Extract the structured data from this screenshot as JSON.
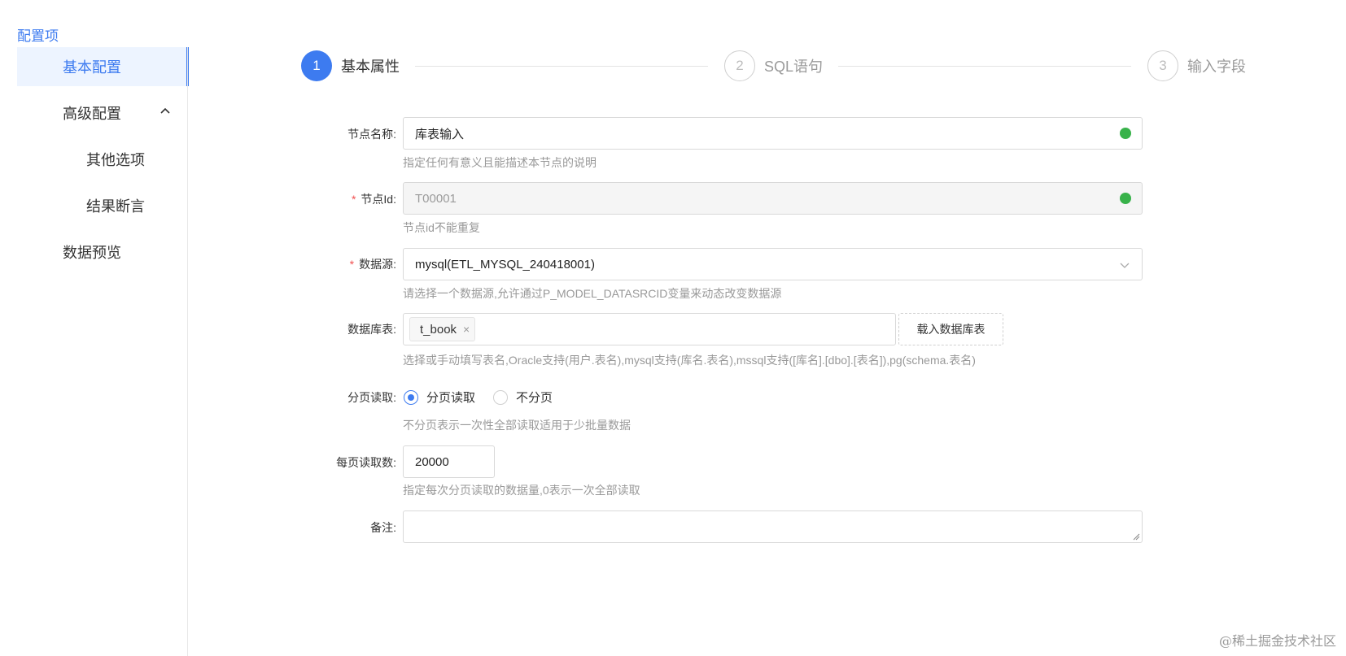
{
  "sidebar": {
    "title": "配置项",
    "items": [
      {
        "label": "基本配置"
      },
      {
        "label": "高级配置"
      },
      {
        "label": "其他选项"
      },
      {
        "label": "结果断言"
      },
      {
        "label": "数据预览"
      }
    ]
  },
  "steps": [
    {
      "number": "1",
      "label": "基本属性"
    },
    {
      "number": "2",
      "label": "SQL语句"
    },
    {
      "number": "3",
      "label": "输入字段"
    }
  ],
  "form": {
    "node_name": {
      "label": "节点名称:",
      "value": "库表输入",
      "hint": "指定任何有意义且能描述本节点的说明"
    },
    "node_id": {
      "required": "*",
      "label": "节点Id:",
      "value": "T00001",
      "hint": "节点id不能重复"
    },
    "datasource": {
      "required": "*",
      "label": "数据源:",
      "value": "mysql(ETL_MYSQL_240418001)",
      "hint": "请选择一个数据源,允许通过P_MODEL_DATASRCID变量来动态改变数据源"
    },
    "db_table": {
      "label": "数据库表:",
      "tag": "t_book",
      "tag_close": "×",
      "load_button": "载入数据库表",
      "hint": "选择或手动填写表名,Oracle支持(用户.表名),mysql支持(库名.表名),mssql支持([库名].[dbo].[表名]),pg(schema.表名)"
    },
    "paging": {
      "label": "分页读取:",
      "options": [
        "分页读取",
        "不分页"
      ],
      "selected": "分页读取",
      "hint": "不分页表示一次性全部读取适用于少批量数据"
    },
    "page_size": {
      "label": "每页读取数:",
      "value": "20000",
      "hint": "指定每次分页读取的数据量,0表示一次全部读取"
    },
    "remark": {
      "label": "备注:",
      "value": ""
    }
  },
  "colors": {
    "accent": "#3d7bf0",
    "success": "#38b24a",
    "required": "#f05050"
  },
  "watermark": "@稀土掘金技术社区"
}
